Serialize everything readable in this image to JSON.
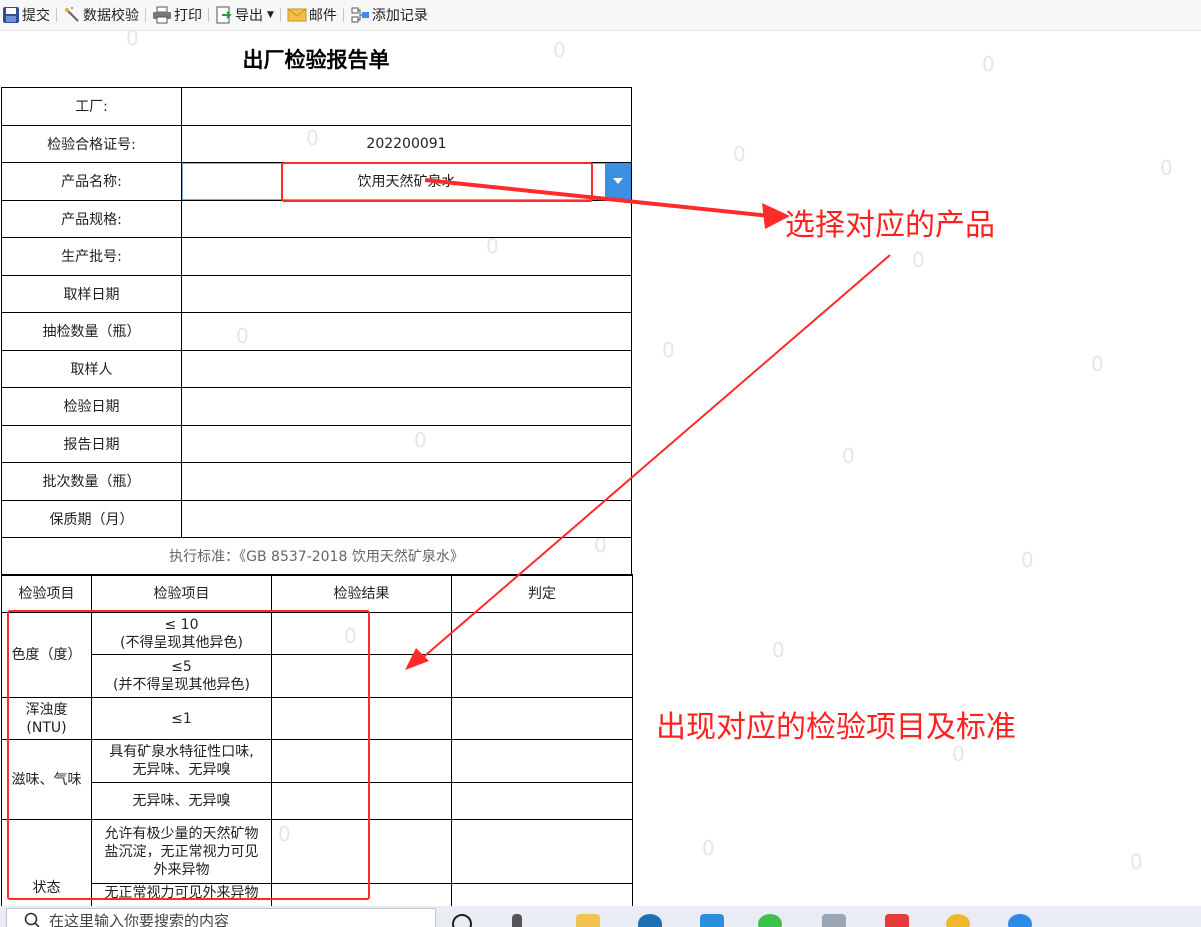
{
  "toolbar": {
    "submit": "提交",
    "validate": "数据校验",
    "print": "打印",
    "export": "导出",
    "mail": "邮件",
    "add_record": "添加记录"
  },
  "report": {
    "title": "出厂检验报告单",
    "fields": [
      {
        "label": "工厂:",
        "value": ""
      },
      {
        "label": "检验合格证号:",
        "value": "202200091"
      },
      {
        "label": "产品名称:",
        "value": "饮用天然矿泉水"
      },
      {
        "label": "产品规格:",
        "value": ""
      },
      {
        "label": "生产批号:",
        "value": ""
      },
      {
        "label": "取样日期",
        "value": ""
      },
      {
        "label": "抽检数量（瓶）",
        "value": ""
      },
      {
        "label": "取样人",
        "value": ""
      },
      {
        "label": "检验日期",
        "value": ""
      },
      {
        "label": "报告日期",
        "value": ""
      },
      {
        "label": "批次数量（瓶）",
        "value": ""
      },
      {
        "label": "保质期（月）",
        "value": ""
      }
    ],
    "standard": "执行标准：《GB 8537-2018 饮用天然矿泉水》"
  },
  "inspection": {
    "headers": [
      "检验项目",
      "检验项目",
      "检验结果",
      "判定"
    ],
    "rows": [
      {
        "item": "色度（度）",
        "spec1": "≤ 10\n(不得呈现其他异色)",
        "spec2": "≤5\n(并不得呈现其他异色)"
      },
      {
        "item": "浑浊度\n(NTU)",
        "spec": "≤1"
      },
      {
        "item": "滋味、气味",
        "spec1": "具有矿泉水特征性口味,\n无异味、无异嗅",
        "spec2": "无异味、无异嗅"
      },
      {
        "item": "状态",
        "spec1": "允许有极少量的天然矿物\n盐沉淀，无正常视力可见\n外来异物",
        "spec2": "无正常视力可见外来异物"
      }
    ]
  },
  "annotations": {
    "select_product": "选择对应的产品",
    "show_items": "出现对应的检验项目及标准",
    "color": "#ff2a2a"
  },
  "watermark": "0",
  "taskbar": {
    "search_placeholder": "在这里输入你要搜索的内容"
  }
}
